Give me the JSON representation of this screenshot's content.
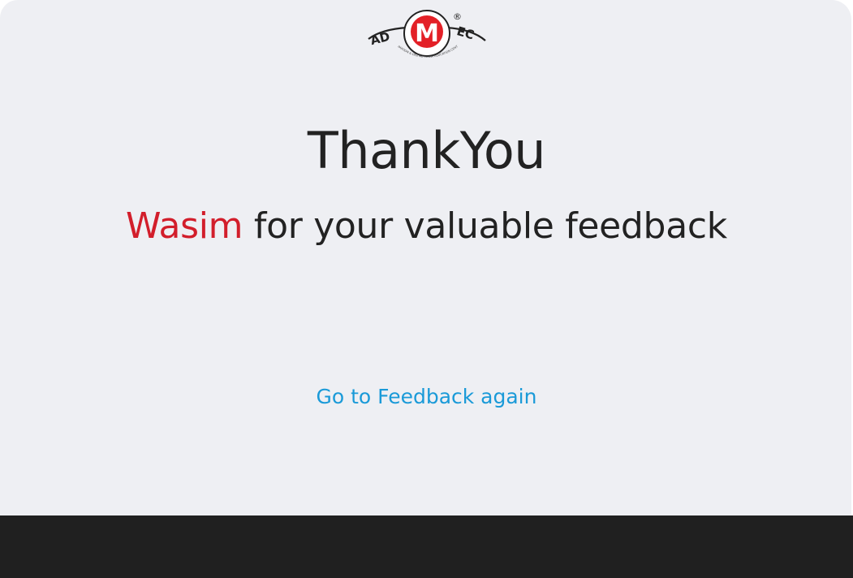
{
  "logo": {
    "text_left": "AD",
    "text_right": "EC",
    "letter": "M",
    "registered": "®",
    "tagline": "ANIMATION & DIGITAL MEDIA EDUCATION CENTRE",
    "brand_color": "#e32027"
  },
  "main": {
    "title": "ThankYou",
    "user_name": "Wasim",
    "message": " for your valuable feedback",
    "link_label": "Go to Feedback again"
  },
  "colors": {
    "background": "#eeeff3",
    "name_accent": "#d21e2b",
    "link": "#1a9ad8",
    "footer": "#202020",
    "text": "#222222"
  }
}
